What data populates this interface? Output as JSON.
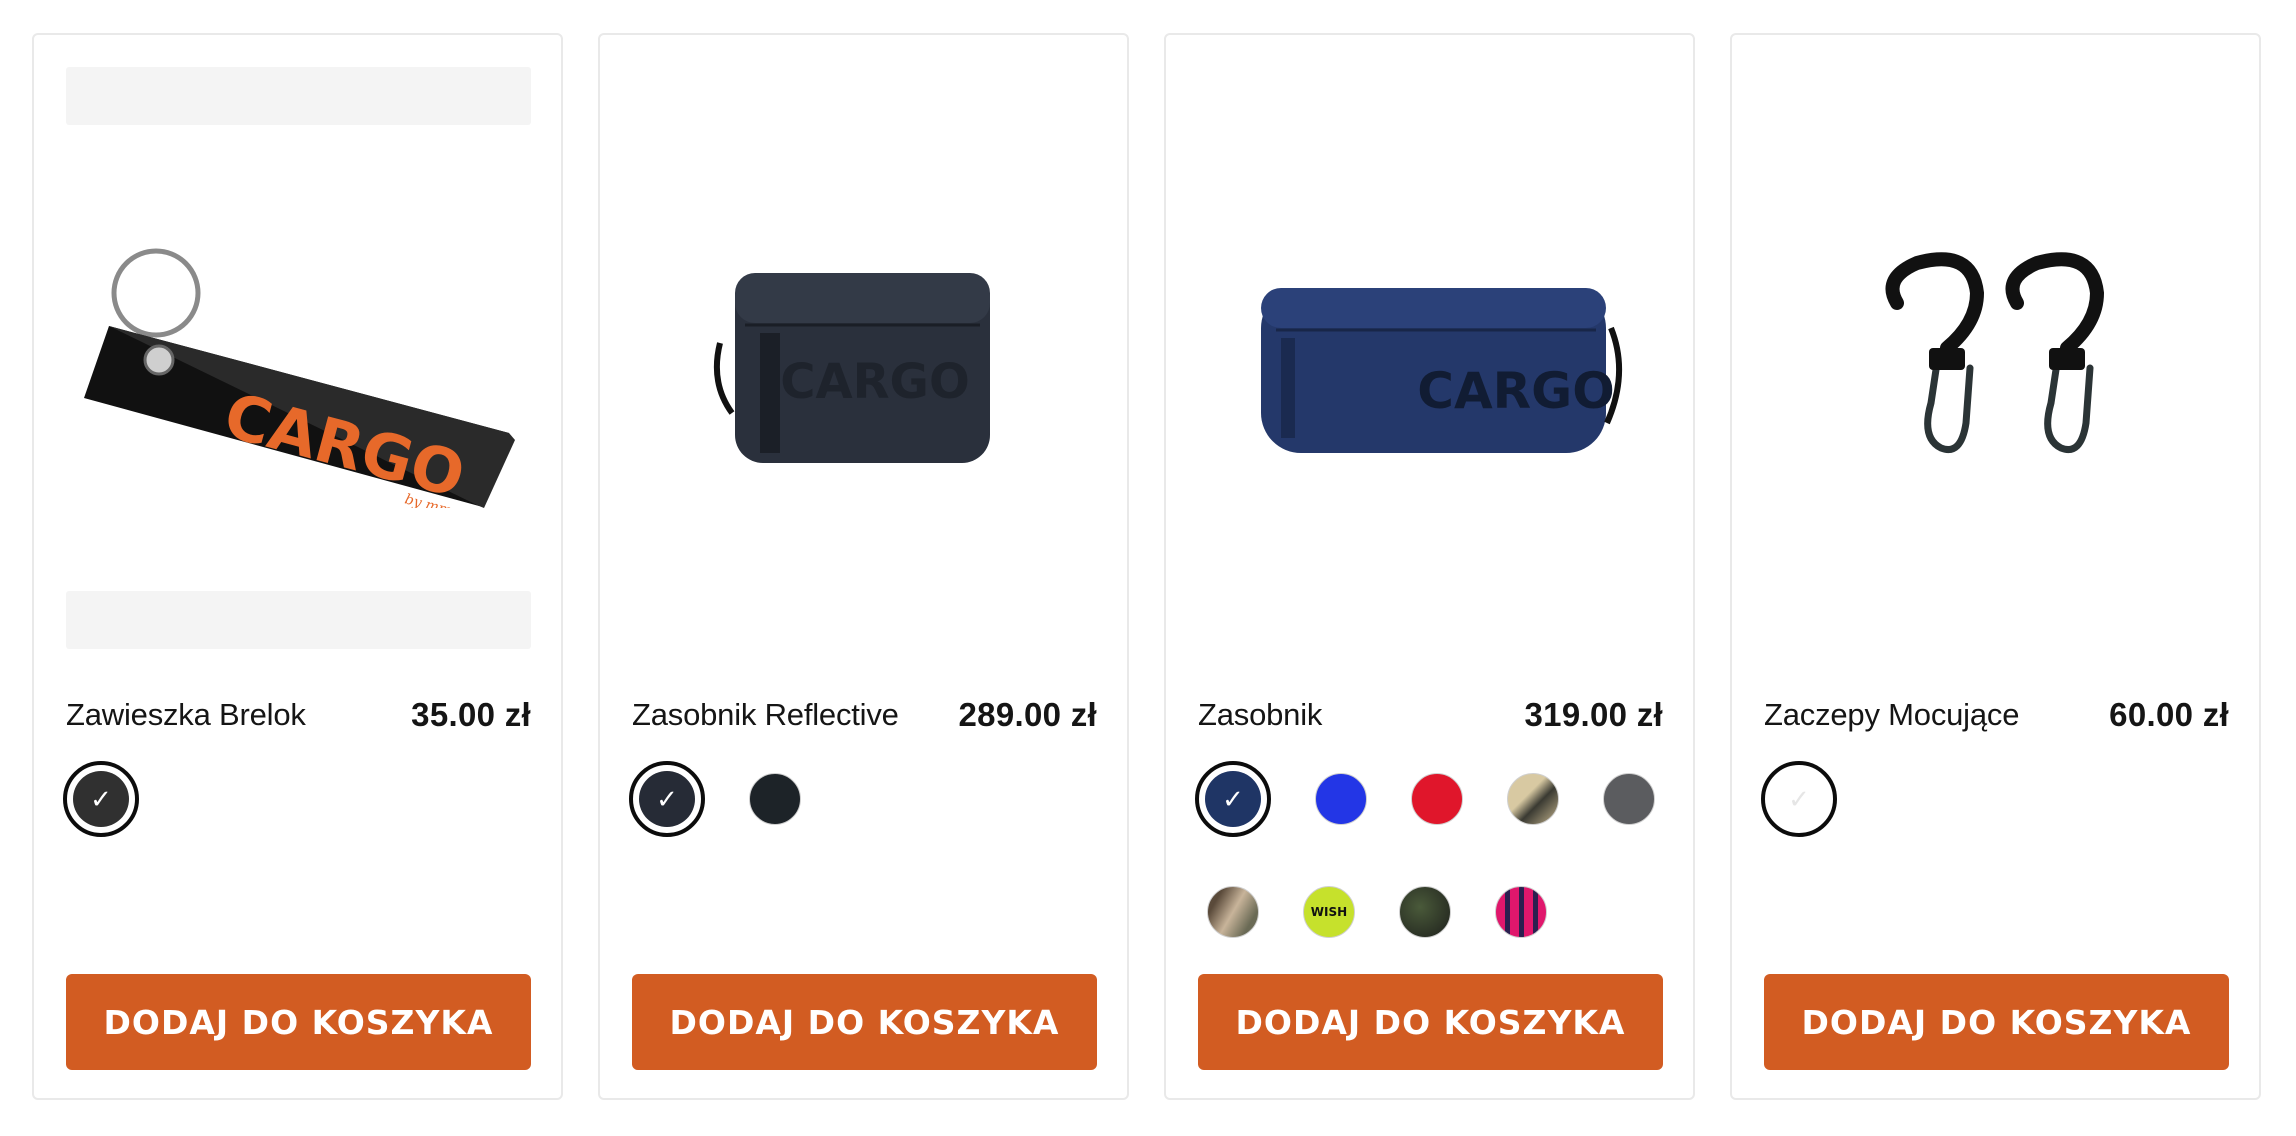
{
  "products": [
    {
      "name": "Zawieszka Brelok",
      "price": "35.00 zł",
      "image_icon": "keychain-tag-icon",
      "logo_text": "CARGO",
      "logo_sub": "by mm",
      "swatches": [
        {
          "color": "#303030",
          "selected": true
        }
      ],
      "button_label": "DODAJ DO KOSZYKA"
    },
    {
      "name": "Zasobnik Reflective",
      "price": "289.00 zł",
      "image_icon": "pouch-bag-icon",
      "logo_text": "CARGO",
      "swatches": [
        {
          "color": "#262b36",
          "selected": true
        },
        {
          "color": "#1d2328",
          "selected": false
        }
      ],
      "button_label": "DODAJ DO KOSZYKA"
    },
    {
      "name": "Zasobnik",
      "price": "319.00 zł",
      "image_icon": "hip-bag-icon",
      "logo_text": "CARGO",
      "swatches": [
        {
          "color": "#1f3565",
          "selected": true
        },
        {
          "color": "#2336e6",
          "selected": false
        },
        {
          "color": "#e0162b",
          "selected": false
        },
        {
          "color": "#c2b28c",
          "selected": false
        },
        {
          "color": "#5b5c5f",
          "selected": false
        },
        {
          "color": "#9a8a72",
          "selected": false
        },
        {
          "color": "#c6e12c",
          "selected": false,
          "text": "WISH"
        },
        {
          "color": "#2d2f2a",
          "selected": false
        },
        {
          "color": "#e0176c",
          "selected": false
        }
      ],
      "button_label": "DODAJ DO KOSZYKA"
    },
    {
      "name": "Zaczepy Mocujące",
      "price": "60.00 zł",
      "image_icon": "clips-icon",
      "swatches": [
        {
          "color": "#ffffff",
          "selected": true
        }
      ],
      "button_label": "DODAJ DO KOSZYKA"
    }
  ],
  "colors": {
    "button": "#d25c22",
    "logo_orange": "#e7692a",
    "card_border": "#e9e9e9"
  }
}
